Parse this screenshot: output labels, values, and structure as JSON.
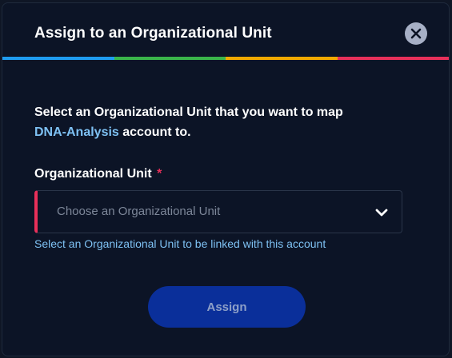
{
  "modal": {
    "title": "Assign to an Organizational Unit",
    "close_icon": "close-icon",
    "accent_colors": [
      "#1f9cf0",
      "#3ab54a",
      "#f2a900",
      "#e8305a"
    ]
  },
  "description": {
    "prefix": "Select an Organizational Unit that you want to map",
    "account_name": "DNA-Analysis",
    "suffix": " account to."
  },
  "field": {
    "label": "Organizational Unit",
    "required_mark": "*",
    "placeholder": "Choose an Organizational Unit",
    "value": "",
    "chevron_icon": "chevron-down-icon",
    "helper": "Select an Organizational Unit to be linked with this account"
  },
  "actions": {
    "assign_label": "Assign"
  },
  "colors": {
    "background": "#0c1426",
    "link": "#7ec1f3",
    "required": "#e8305a",
    "button": "#0a2f9a"
  }
}
